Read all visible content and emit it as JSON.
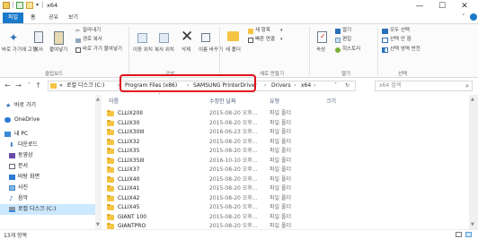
{
  "window": {
    "title": "x64",
    "controls": {
      "minimize": "—",
      "maximize": "☐",
      "close": "✕"
    }
  },
  "tabs": [
    "파일",
    "홈",
    "공유",
    "보기"
  ],
  "ribbon": {
    "pin_label": "바로 가기에 고정",
    "copy_label": "복사",
    "paste_label": "붙여넣기",
    "cut_label": "잘라내기",
    "copy_path_label": "경로 복사",
    "paste_shortcut_label": "바로 가기 붙여넣기",
    "move_to_label": "이동 위치",
    "copy_to_label": "복사 위치",
    "delete_label": "삭제",
    "rename_label": "이름 바꾸기",
    "new_folder_label": "새 폴더",
    "new_item_label": "새 항목",
    "easy_access_label": "빠른 연결",
    "properties_label": "속성",
    "open_label": "열기",
    "edit_label": "편집",
    "history_label": "히스토리",
    "select_all_label": "모두 선택",
    "select_none_label": "선택 안 함",
    "invert_selection_label": "선택 영역 반전",
    "groups": {
      "clipboard": "클립보드",
      "organize": "구성",
      "new": "새로 만들기",
      "open": "열기",
      "select": "선택"
    }
  },
  "address": {
    "crumbs": [
      "«",
      "로컬 디스크 (C:)",
      "Program Files (x86)",
      "SAMSUNG PrinterDriver",
      "Drivers",
      "x64"
    ],
    "separator": "›",
    "search_placeholder": "x64 검색"
  },
  "nav": {
    "items": [
      {
        "label": "바로 가기",
        "icon": "star-icon"
      },
      {
        "label": "OneDrive",
        "icon": "cloud-icon"
      },
      {
        "label": "내 PC",
        "icon": "pc-icon"
      },
      {
        "label": "다운로드",
        "icon": "download-icon"
      },
      {
        "label": "동영상",
        "icon": "video-icon"
      },
      {
        "label": "문서",
        "icon": "document-icon"
      },
      {
        "label": "바탕 화면",
        "icon": "desktop-icon"
      },
      {
        "label": "사진",
        "icon": "picture-icon"
      },
      {
        "label": "음악",
        "icon": "music-icon"
      },
      {
        "label": "로컬 디스크 (C:)",
        "icon": "drive-icon"
      }
    ]
  },
  "columns": {
    "name": "이름",
    "modified": "수정한 날짜",
    "type": "유형",
    "size": "크기"
  },
  "files": [
    {
      "name": "CLLIX20II",
      "modified": "2015-08-20 오후...",
      "type": "파일 폴더"
    },
    {
      "name": "CLLIX30",
      "modified": "2015-08-20 오후...",
      "type": "파일 폴더"
    },
    {
      "name": "CLLIX30III",
      "modified": "2016-06-23 오후...",
      "type": "파일 폴더"
    },
    {
      "name": "CLLIX32",
      "modified": "2015-08-20 오후...",
      "type": "파일 폴더"
    },
    {
      "name": "CLLIX35",
      "modified": "2015-08-20 오후...",
      "type": "파일 폴더"
    },
    {
      "name": "CLLIX35III",
      "modified": "2016-10-10 오후...",
      "type": "파일 폴더"
    },
    {
      "name": "CLLIX37",
      "modified": "2015-08-20 오후...",
      "type": "파일 폴더"
    },
    {
      "name": "CLLIX40",
      "modified": "2015-08-20 오후...",
      "type": "파일 폴더"
    },
    {
      "name": "CLLIX41",
      "modified": "2015-08-20 오후...",
      "type": "파일 폴더"
    },
    {
      "name": "CLLIX42",
      "modified": "2015-08-20 오후...",
      "type": "파일 폴더"
    },
    {
      "name": "CLLIX45",
      "modified": "2015-08-20 오후...",
      "type": "파일 폴더"
    },
    {
      "name": "GIANT 100",
      "modified": "2015-08-20 오후...",
      "type": "파일 폴더"
    },
    {
      "name": "GIANTPRO",
      "modified": "2015-08-20 오후...",
      "type": "파일 폴더"
    }
  ],
  "status": {
    "count": "13개 항목"
  }
}
